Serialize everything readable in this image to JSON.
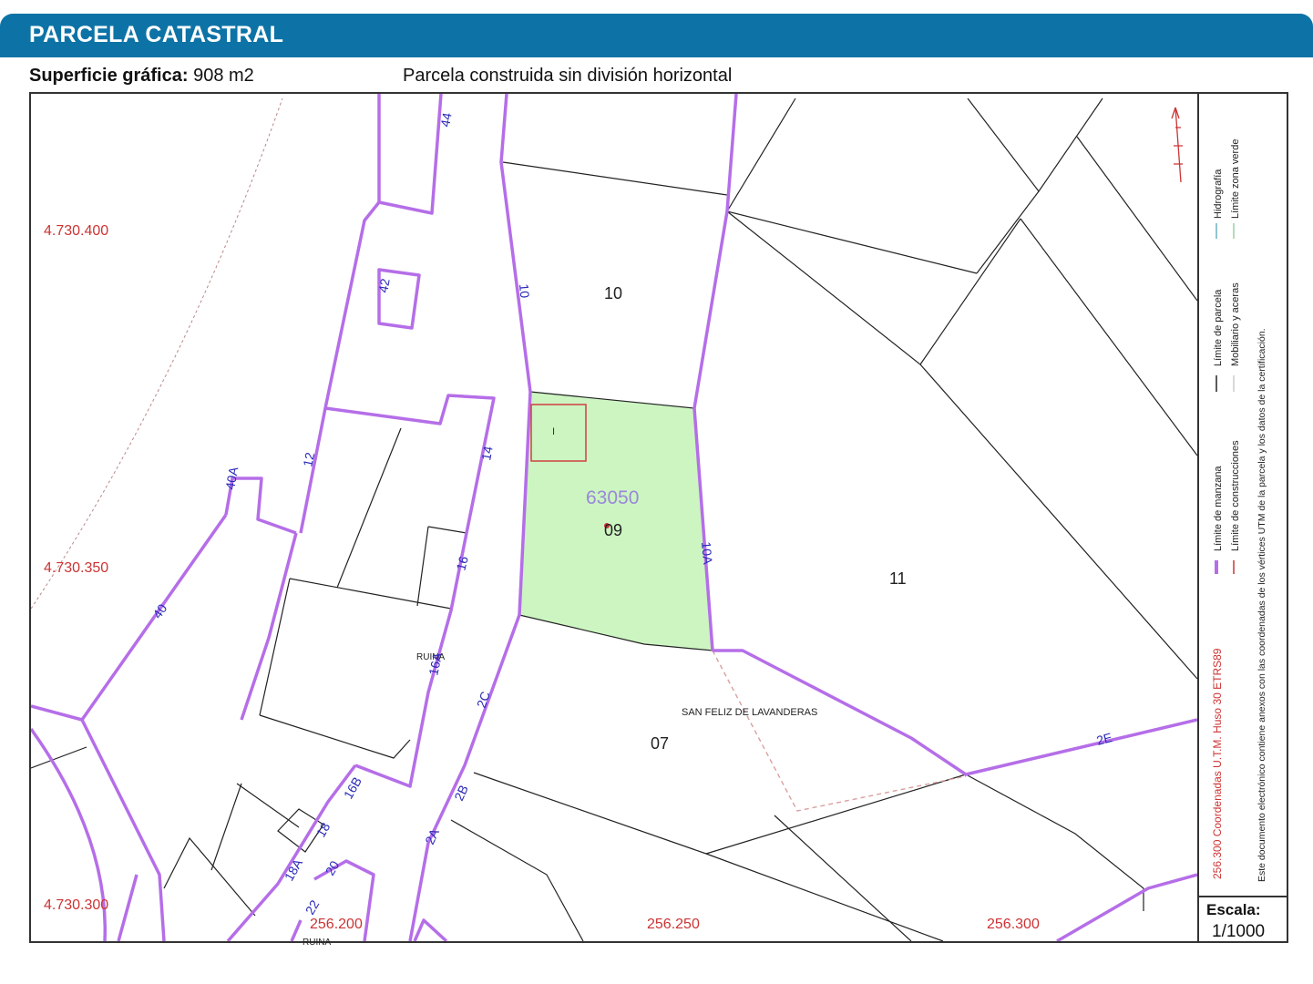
{
  "header": {
    "title": "PARCELA CATASTRAL"
  },
  "info": {
    "area_label": "Superficie gráfica:",
    "area_value": "908 m2",
    "parcel_type": "Parcela construida sin división horizontal"
  },
  "map": {
    "y_coords": [
      "4.730.400",
      "4.730.350",
      "4.730.300"
    ],
    "x_coords": [
      "256.200",
      "256.250",
      "256.300"
    ],
    "parcel_ref": "63050",
    "parcel_numbers": [
      "10",
      "09",
      "11",
      "07"
    ],
    "street_numbers": [
      "44",
      "42",
      "40A",
      "40",
      "12",
      "14",
      "16",
      "16A",
      "10",
      "10A",
      "2C",
      "2B",
      "2A",
      "2E",
      "16B",
      "18",
      "18A",
      "20",
      "22"
    ],
    "building_code": "I",
    "ruin_labels": [
      "RUINA",
      "RUINA"
    ],
    "place_name": "SAN FELIZ DE LAVANDERAS",
    "colors": {
      "selected_fill": "#ccf5c2",
      "block_line": "#b56ee8",
      "coord_text": "#cc3333",
      "ref_text": "#9a88d8",
      "number_blue": "#2a2ab8"
    }
  },
  "legend": {
    "col1": [
      "Límite de manzana",
      "Límite de construcciones"
    ],
    "col2": [
      "Límite de parcela",
      "Mobiliario y aceras"
    ],
    "col3": [
      "Hidrografía",
      "Límite zona verde"
    ],
    "utm_note": "256.300 Coordenadas U.T.M. Huso 30 ETRS89",
    "certification_note": "Este documento electrónico contiene anexos con las coordenadas de los vértices UTM de la parcela y los datos de la certificación."
  },
  "scale": {
    "label": "Escala:",
    "value": "1/1000"
  }
}
